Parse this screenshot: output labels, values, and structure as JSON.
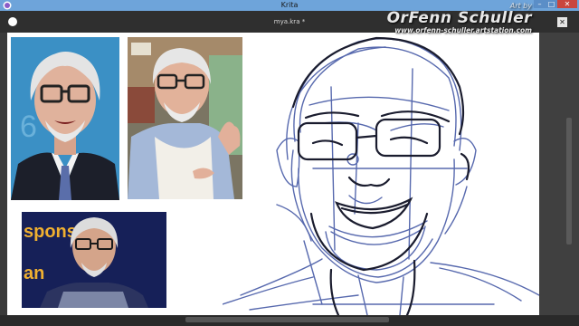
{
  "window": {
    "title": "Krita",
    "min_glyph": "–",
    "max_glyph": "□",
    "close_glyph": "✕"
  },
  "document": {
    "title": "mya.kra *",
    "close_glyph": "✕"
  },
  "watermark": {
    "label": "Art by",
    "name": "OrFenn Schuller",
    "url": "www.orfenn-schuller.artstation.com"
  },
  "photo3": {
    "banner_text": "spons ' Ch"
  },
  "colors": {
    "titlebar": "#6ea4da",
    "canvas": "#ffffff",
    "sketch_stroke": "#3a4fa0",
    "ink_stroke": "#1a1c2e",
    "close_button": "#c9463d"
  }
}
